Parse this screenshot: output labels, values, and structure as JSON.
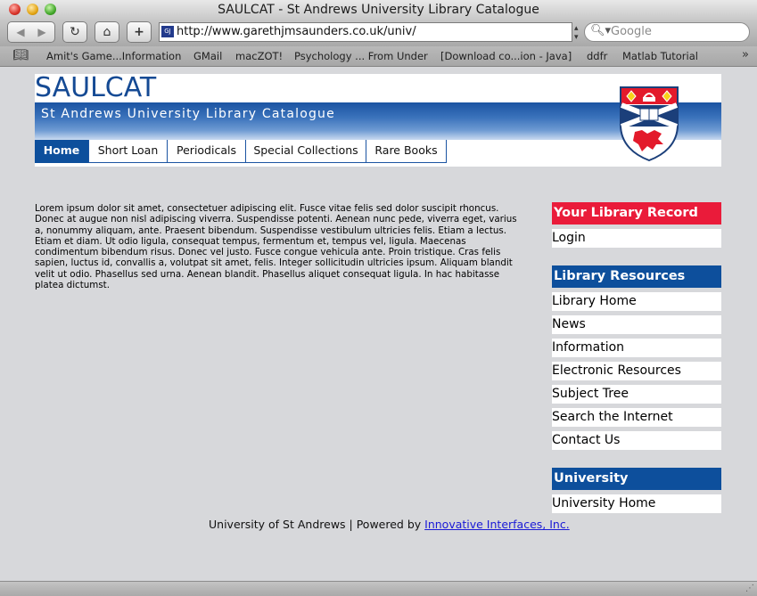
{
  "window": {
    "title": "SAULCAT - St Andrews University Library Catalogue"
  },
  "toolbar": {
    "back_glyph": "◀",
    "forward_glyph": "▶",
    "reload_glyph": "↻",
    "home_glyph": "⌂",
    "add_glyph": "+",
    "favicon_text": "GJ",
    "url": "http://www.garethjmsaunders.co.uk/univ/",
    "search_placeholder": "Google"
  },
  "bookmarks": [
    "Amit's Game...Information",
    "GMail",
    "macZOT!",
    "Psychology ... From Under",
    "[Download co...ion - Java]",
    "ddfr",
    "Matlab Tutorial"
  ],
  "header": {
    "site_title": "SAULCAT",
    "subtitle": "St Andrews University Library Catalogue"
  },
  "nav": [
    {
      "label": "Home",
      "active": true
    },
    {
      "label": "Short Loan"
    },
    {
      "label": "Periodicals"
    },
    {
      "label": "Special Collections"
    },
    {
      "label": "Rare Books"
    }
  ],
  "main": {
    "body_text": "Lorem ipsum dolor sit amet, consectetuer adipiscing elit. Fusce vitae felis sed dolor suscipit rhoncus. Donec at augue non nisl adipiscing viverra. Suspendisse potenti. Aenean nunc pede, viverra eget, varius a, nonummy aliquam, ante. Praesent bibendum. Suspendisse vestibulum ultricies felis. Etiam a lectus. Etiam et diam. Ut odio ligula, consequat tempus, fermentum et, tempus vel, ligula. Maecenas condimentum bibendum risus. Donec vel justo. Fusce congue vehicula ante. Proin tristique. Cras felis sapien, luctus id, convallis a, volutpat sit amet, felis. Integer sollicitudin ultricies ipsum. Aliquam blandit velit ut odio. Phasellus sed urna. Aenean blandit. Phasellus aliquet consequat ligula. In hac habitasse platea dictumst."
  },
  "sidebar": {
    "record_heading": "Your Library Record",
    "record_links": [
      "Login"
    ],
    "resources_heading": "Library Resources",
    "resources_links": [
      "Library Home",
      "News",
      "Information",
      "Electronic Resources",
      "Subject Tree",
      "Search the Internet",
      "Contact Us"
    ],
    "university_heading": "University",
    "university_links": [
      "University Home"
    ]
  },
  "footer": {
    "text": "University of St Andrews | Powered by ",
    "link_text": "Innovative Interfaces, Inc."
  },
  "colors": {
    "brand_blue": "#0d4f9c",
    "record_red": "#ea1b3a"
  }
}
